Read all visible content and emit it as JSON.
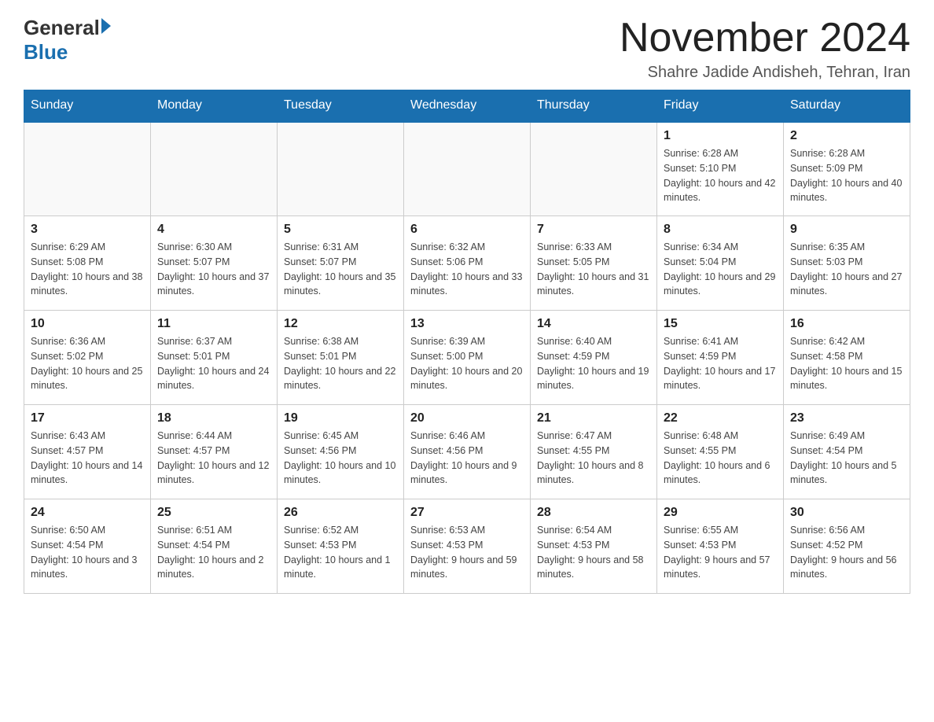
{
  "header": {
    "logo_general": "General",
    "logo_blue": "Blue",
    "month_title": "November 2024",
    "location": "Shahre Jadide Andisheh, Tehran, Iran"
  },
  "weekdays": [
    "Sunday",
    "Monday",
    "Tuesday",
    "Wednesday",
    "Thursday",
    "Friday",
    "Saturday"
  ],
  "weeks": [
    [
      {
        "day": "",
        "info": ""
      },
      {
        "day": "",
        "info": ""
      },
      {
        "day": "",
        "info": ""
      },
      {
        "day": "",
        "info": ""
      },
      {
        "day": "",
        "info": ""
      },
      {
        "day": "1",
        "info": "Sunrise: 6:28 AM\nSunset: 5:10 PM\nDaylight: 10 hours and 42 minutes."
      },
      {
        "day": "2",
        "info": "Sunrise: 6:28 AM\nSunset: 5:09 PM\nDaylight: 10 hours and 40 minutes."
      }
    ],
    [
      {
        "day": "3",
        "info": "Sunrise: 6:29 AM\nSunset: 5:08 PM\nDaylight: 10 hours and 38 minutes."
      },
      {
        "day": "4",
        "info": "Sunrise: 6:30 AM\nSunset: 5:07 PM\nDaylight: 10 hours and 37 minutes."
      },
      {
        "day": "5",
        "info": "Sunrise: 6:31 AM\nSunset: 5:07 PM\nDaylight: 10 hours and 35 minutes."
      },
      {
        "day": "6",
        "info": "Sunrise: 6:32 AM\nSunset: 5:06 PM\nDaylight: 10 hours and 33 minutes."
      },
      {
        "day": "7",
        "info": "Sunrise: 6:33 AM\nSunset: 5:05 PM\nDaylight: 10 hours and 31 minutes."
      },
      {
        "day": "8",
        "info": "Sunrise: 6:34 AM\nSunset: 5:04 PM\nDaylight: 10 hours and 29 minutes."
      },
      {
        "day": "9",
        "info": "Sunrise: 6:35 AM\nSunset: 5:03 PM\nDaylight: 10 hours and 27 minutes."
      }
    ],
    [
      {
        "day": "10",
        "info": "Sunrise: 6:36 AM\nSunset: 5:02 PM\nDaylight: 10 hours and 25 minutes."
      },
      {
        "day": "11",
        "info": "Sunrise: 6:37 AM\nSunset: 5:01 PM\nDaylight: 10 hours and 24 minutes."
      },
      {
        "day": "12",
        "info": "Sunrise: 6:38 AM\nSunset: 5:01 PM\nDaylight: 10 hours and 22 minutes."
      },
      {
        "day": "13",
        "info": "Sunrise: 6:39 AM\nSunset: 5:00 PM\nDaylight: 10 hours and 20 minutes."
      },
      {
        "day": "14",
        "info": "Sunrise: 6:40 AM\nSunset: 4:59 PM\nDaylight: 10 hours and 19 minutes."
      },
      {
        "day": "15",
        "info": "Sunrise: 6:41 AM\nSunset: 4:59 PM\nDaylight: 10 hours and 17 minutes."
      },
      {
        "day": "16",
        "info": "Sunrise: 6:42 AM\nSunset: 4:58 PM\nDaylight: 10 hours and 15 minutes."
      }
    ],
    [
      {
        "day": "17",
        "info": "Sunrise: 6:43 AM\nSunset: 4:57 PM\nDaylight: 10 hours and 14 minutes."
      },
      {
        "day": "18",
        "info": "Sunrise: 6:44 AM\nSunset: 4:57 PM\nDaylight: 10 hours and 12 minutes."
      },
      {
        "day": "19",
        "info": "Sunrise: 6:45 AM\nSunset: 4:56 PM\nDaylight: 10 hours and 10 minutes."
      },
      {
        "day": "20",
        "info": "Sunrise: 6:46 AM\nSunset: 4:56 PM\nDaylight: 10 hours and 9 minutes."
      },
      {
        "day": "21",
        "info": "Sunrise: 6:47 AM\nSunset: 4:55 PM\nDaylight: 10 hours and 8 minutes."
      },
      {
        "day": "22",
        "info": "Sunrise: 6:48 AM\nSunset: 4:55 PM\nDaylight: 10 hours and 6 minutes."
      },
      {
        "day": "23",
        "info": "Sunrise: 6:49 AM\nSunset: 4:54 PM\nDaylight: 10 hours and 5 minutes."
      }
    ],
    [
      {
        "day": "24",
        "info": "Sunrise: 6:50 AM\nSunset: 4:54 PM\nDaylight: 10 hours and 3 minutes."
      },
      {
        "day": "25",
        "info": "Sunrise: 6:51 AM\nSunset: 4:54 PM\nDaylight: 10 hours and 2 minutes."
      },
      {
        "day": "26",
        "info": "Sunrise: 6:52 AM\nSunset: 4:53 PM\nDaylight: 10 hours and 1 minute."
      },
      {
        "day": "27",
        "info": "Sunrise: 6:53 AM\nSunset: 4:53 PM\nDaylight: 9 hours and 59 minutes."
      },
      {
        "day": "28",
        "info": "Sunrise: 6:54 AM\nSunset: 4:53 PM\nDaylight: 9 hours and 58 minutes."
      },
      {
        "day": "29",
        "info": "Sunrise: 6:55 AM\nSunset: 4:53 PM\nDaylight: 9 hours and 57 minutes."
      },
      {
        "day": "30",
        "info": "Sunrise: 6:56 AM\nSunset: 4:52 PM\nDaylight: 9 hours and 56 minutes."
      }
    ]
  ]
}
